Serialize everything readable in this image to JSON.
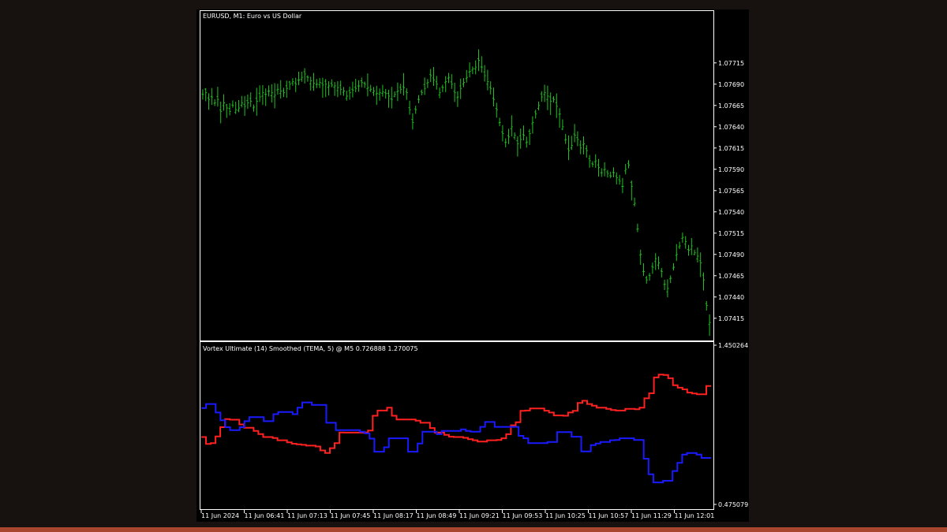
{
  "colors": {
    "background": "#17120f",
    "chart_bg": "#000000",
    "frame": "#ffffff",
    "candles": "#1fc01f",
    "vortex_plus": "#ff2020",
    "vortex_minus": "#1a1aff",
    "bottom_strip": "#a9472e"
  },
  "chart_data": [
    {
      "type": "line",
      "title": "EURUSD, M1:  Euro vs US Dollar",
      "y_tick_labels": [
        "1.07715",
        "1.07690",
        "1.07665",
        "1.07640",
        "1.07615",
        "1.07590",
        "1.07565",
        "1.07540",
        "1.07515",
        "1.07490",
        "1.07465",
        "1.07440",
        "1.07415"
      ],
      "ylim": [
        1.074,
        1.0775
      ],
      "series": [
        {
          "values": [
            1.07678,
            1.0768,
            1.07672,
            1.07675,
            1.07668,
            1.07672,
            1.07658,
            1.07668,
            1.07662,
            1.07658,
            1.07665,
            1.0766,
            1.07662,
            1.07668,
            1.07664,
            1.07668,
            1.0767,
            1.07663,
            1.0767,
            1.07675,
            1.0768,
            1.07678,
            1.07682,
            1.0768,
            1.07677,
            1.07684,
            1.07682,
            1.0768,
            1.07685,
            1.0769,
            1.07693,
            1.0769,
            1.07695,
            1.07698,
            1.07702,
            1.07698,
            1.07694,
            1.07691,
            1.0769,
            1.07692,
            1.07689,
            1.0769,
            1.07688,
            1.07689,
            1.07688,
            1.07686,
            1.07684,
            1.07682,
            1.07676,
            1.0768,
            1.07683,
            1.07685,
            1.07688,
            1.07692,
            1.0769,
            1.07686,
            1.07684,
            1.07682,
            1.07679,
            1.0768,
            1.07681,
            1.07679,
            1.07676,
            1.07672,
            1.07678,
            1.07682,
            1.07684,
            1.07686,
            1.0768,
            1.0766,
            1.07645,
            1.0766,
            1.07672,
            1.0768,
            1.07685,
            1.07692,
            1.077,
            1.07695,
            1.0769,
            1.0768,
            1.07686,
            1.07693,
            1.07698,
            1.0769,
            1.0768,
            1.07675,
            1.07685,
            1.07692,
            1.07698,
            1.07705,
            1.07708,
            1.0771,
            1.07718,
            1.0771,
            1.077,
            1.07693,
            1.07685,
            1.07672,
            1.0766,
            1.07645,
            1.07632,
            1.07622,
            1.07628,
            1.0764,
            1.0763,
            1.0762,
            1.07625,
            1.0763,
            1.07622,
            1.07632,
            1.07645,
            1.07655,
            1.07665,
            1.07675,
            1.0768,
            1.07676,
            1.0767,
            1.07672,
            1.07664,
            1.07655,
            1.0764,
            1.07625,
            1.07612,
            1.07618,
            1.0763,
            1.07625,
            1.07615,
            1.0762,
            1.07612,
            1.076,
            1.07596,
            1.076,
            1.07592,
            1.07586,
            1.0759,
            1.07585,
            1.07582,
            1.07586,
            1.0758,
            1.07576,
            1.0757,
            1.0759,
            1.07595,
            1.0757,
            1.0755,
            1.0752,
            1.0749,
            1.0747,
            1.0746,
            1.07465,
            1.07475,
            1.07485,
            1.0748,
            1.0747,
            1.07455,
            1.0745,
            1.07462,
            1.07475,
            1.0749,
            1.075,
            1.0751,
            1.07505,
            1.07495,
            1.075,
            1.07492,
            1.07488,
            1.0748,
            1.0746,
            1.0743,
            1.0741
          ]
        }
      ]
    },
    {
      "type": "line",
      "title": "Vortex Ultimate (14) Smoothed (TEMA, 5)  @ M5 0.726888 1.270075",
      "y_tick_labels": [
        "1.450264",
        "0.475079"
      ],
      "ylim": [
        0.475079,
        1.450264
      ],
      "x_tick_labels": [
        "11 Jun 2024",
        "11 Jun 06:41",
        "11 Jun 07:13",
        "11 Jun 07:45",
        "11 Jun 08:17",
        "11 Jun 08:49",
        "11 Jun 09:21",
        "11 Jun 09:53",
        "11 Jun 10:25",
        "11 Jun 10:57",
        "11 Jun 11:29",
        "11 Jun 12:01"
      ],
      "series": [
        {
          "color": "#ff2020",
          "values": [
            0.888,
            0.846,
            0.85,
            0.891,
            0.948,
            0.998,
            0.994,
            0.994,
            0.965,
            0.945,
            0.945,
            0.925,
            0.906,
            0.888,
            0.888,
            0.882,
            0.868,
            0.868,
            0.855,
            0.847,
            0.843,
            0.84,
            0.835,
            0.835,
            0.83,
            0.806,
            0.79,
            0.82,
            0.85,
            0.916,
            0.915,
            0.915,
            0.915,
            0.915,
            0.916,
            0.928,
            1.018,
            1.05,
            1.05,
            1.068,
            1.018,
            0.995,
            0.995,
            0.995,
            0.995,
            0.988,
            0.975,
            0.975,
            0.943,
            0.915,
            0.915,
            0.901,
            0.89,
            0.888,
            0.888,
            0.883,
            0.875,
            0.868,
            0.86,
            0.86,
            0.868,
            0.868,
            0.87,
            0.88,
            0.905,
            0.96,
            0.978,
            1.048,
            1.05,
            1.063,
            1.063,
            1.063,
            1.049,
            1.038,
            1.02,
            1.02,
            1.018,
            1.038,
            1.048,
            1.097,
            1.11,
            1.09,
            1.08,
            1.068,
            1.068,
            1.06,
            1.053,
            1.05,
            1.05,
            1.06,
            1.06,
            1.058,
            1.068,
            1.125,
            1.156,
            1.253,
            1.27,
            1.268,
            1.248,
            1.205,
            1.19,
            1.18,
            1.16,
            1.155,
            1.15,
            1.15,
            1.2
          ]
        },
        {
          "color": "#1a1aff",
          "values": [
            1.065,
            1.09,
            1.09,
            1.038,
            0.99,
            0.948,
            0.93,
            0.93,
            0.948,
            0.985,
            1.01,
            1.01,
            1.01,
            0.985,
            0.985,
            1.028,
            1.041,
            1.041,
            1.041,
            1.028,
            1.068,
            1.1,
            1.1,
            1.085,
            1.085,
            1.085,
            0.975,
            0.975,
            0.93,
            0.93,
            0.93,
            0.93,
            0.93,
            0.92,
            0.91,
            0.878,
            0.798,
            0.798,
            0.825,
            0.88,
            0.88,
            0.88,
            0.88,
            0.798,
            0.798,
            0.848,
            0.92,
            0.92,
            0.92,
            0.905,
            0.925,
            0.925,
            0.925,
            0.925,
            0.935,
            0.925,
            0.92,
            0.92,
            0.95,
            0.98,
            0.98,
            0.95,
            0.95,
            0.95,
            0.95,
            0.95,
            0.895,
            0.88,
            0.85,
            0.85,
            0.85,
            0.85,
            0.858,
            0.858,
            0.918,
            0.918,
            0.918,
            0.89,
            0.89,
            0.8,
            0.8,
            0.838,
            0.848,
            0.858,
            0.858,
            0.868,
            0.87,
            0.88,
            0.88,
            0.88,
            0.87,
            0.87,
            0.755,
            0.66,
            0.61,
            0.61,
            0.62,
            0.62,
            0.68,
            0.73,
            0.78,
            0.79,
            0.79,
            0.78,
            0.76,
            0.76
          ]
        }
      ]
    }
  ]
}
